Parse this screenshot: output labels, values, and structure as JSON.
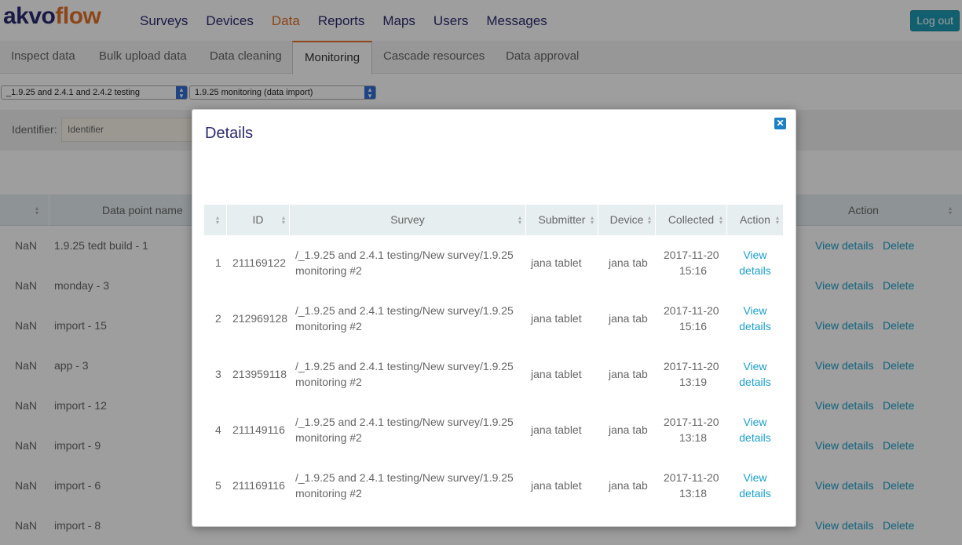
{
  "brand": {
    "part1": "akvo",
    "part2": "flow"
  },
  "nav": {
    "items": [
      "Surveys",
      "Devices",
      "Data",
      "Reports",
      "Maps",
      "Users",
      "Messages"
    ],
    "active_index": 2,
    "logout": "Log out"
  },
  "subnav": {
    "tabs": [
      "Inspect data",
      "Bulk upload data",
      "Data cleaning",
      "Monitoring",
      "Cascade resources",
      "Data approval"
    ],
    "active_index": 3
  },
  "selects": {
    "survey_group": "_1.9.25 and 2.4.1 and 2.4.2 testing",
    "form": "1.9.25 monitoring (data import)"
  },
  "filter": {
    "label": "Identifier:",
    "placeholder": "Identifier"
  },
  "bg_table": {
    "headers": {
      "data_point_name": "Data point name",
      "action": "Action"
    },
    "rows": [
      {
        "id": "NaN",
        "name": "1.9.25 tedt build - 1"
      },
      {
        "id": "NaN",
        "name": "monday - 3"
      },
      {
        "id": "NaN",
        "name": "import - 15"
      },
      {
        "id": "NaN",
        "name": "app - 3"
      },
      {
        "id": "NaN",
        "name": "import - 12"
      },
      {
        "id": "NaN",
        "name": "import - 9"
      },
      {
        "id": "NaN",
        "name": "import - 6"
      },
      {
        "id": "NaN",
        "name": "import - 8"
      }
    ],
    "view_details": "View details",
    "delete": "Delete"
  },
  "modal": {
    "title": "Details",
    "columns": [
      "ID",
      "Survey",
      "Submitter",
      "Device",
      "Collected",
      "Action"
    ],
    "rows": [
      {
        "num": "1",
        "id": "211169122",
        "survey_l1": "/_1.9.25 and 2.4.1 testing/New survey/1.9.25",
        "survey_l2": "monitoring #2",
        "submitter": "jana tablet",
        "device": "jana tab",
        "date": "2017-11-20",
        "time": "15:16",
        "action_l1": "View",
        "action_l2": "details"
      },
      {
        "num": "2",
        "id": "212969128",
        "survey_l1": "/_1.9.25 and 2.4.1 testing/New survey/1.9.25",
        "survey_l2": "monitoring #2",
        "submitter": "jana tablet",
        "device": "jana tab",
        "date": "2017-11-20",
        "time": "15:16",
        "action_l1": "View",
        "action_l2": "details"
      },
      {
        "num": "3",
        "id": "213959118",
        "survey_l1": "/_1.9.25 and 2.4.1 testing/New survey/1.9.25",
        "survey_l2": "monitoring #2",
        "submitter": "jana tablet",
        "device": "jana tab",
        "date": "2017-11-20",
        "time": "13:19",
        "action_l1": "View",
        "action_l2": "details"
      },
      {
        "num": "4",
        "id": "211149116",
        "survey_l1": "/_1.9.25 and 2.4.1 testing/New survey/1.9.25",
        "survey_l2": "monitoring #2",
        "submitter": "jana tablet",
        "device": "jana tab",
        "date": "2017-11-20",
        "time": "13:18",
        "action_l1": "View",
        "action_l2": "details"
      },
      {
        "num": "5",
        "id": "211169116",
        "survey_l1": "/_1.9.25 and 2.4.1 testing/New survey/1.9.25",
        "survey_l2": "monitoring #2",
        "submitter": "jana tablet",
        "device": "jana tab",
        "date": "2017-11-20",
        "time": "13:18",
        "action_l1": "View",
        "action_l2": "details"
      }
    ]
  },
  "colors": {
    "brand_navy": "#2b2a6e",
    "brand_orange": "#e27127",
    "link": "#1ba0c8",
    "button": "#1d9bb4"
  }
}
